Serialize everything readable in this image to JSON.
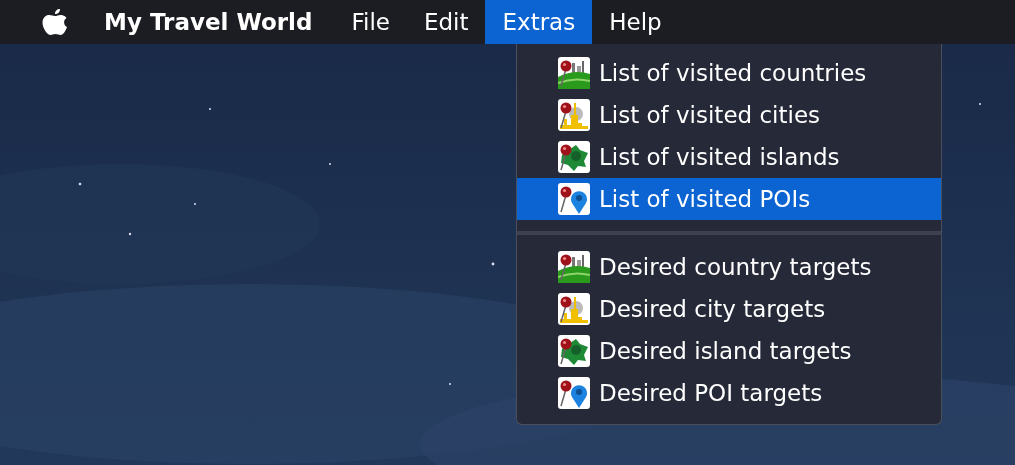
{
  "menubar": {
    "app_name": "My Travel World",
    "menus": [
      {
        "label": "File",
        "selected": false
      },
      {
        "label": "Edit",
        "selected": false
      },
      {
        "label": "Extras",
        "selected": true
      },
      {
        "label": "Help",
        "selected": false
      }
    ]
  },
  "dropdown": {
    "sections": [
      {
        "items": [
          {
            "label": "List of visited countries",
            "kind": "country",
            "selected": false
          },
          {
            "label": "List of visited cities",
            "kind": "city",
            "selected": false
          },
          {
            "label": "List of visited islands",
            "kind": "island",
            "selected": false
          },
          {
            "label": "List of visited POIs",
            "kind": "poi",
            "selected": true
          }
        ]
      },
      {
        "items": [
          {
            "label": "Desired country targets",
            "kind": "country",
            "selected": false
          },
          {
            "label": "Desired city targets",
            "kind": "city",
            "selected": false
          },
          {
            "label": "Desired island targets",
            "kind": "island",
            "selected": false
          },
          {
            "label": "Desired POI targets",
            "kind": "poi",
            "selected": false
          }
        ]
      }
    ]
  }
}
